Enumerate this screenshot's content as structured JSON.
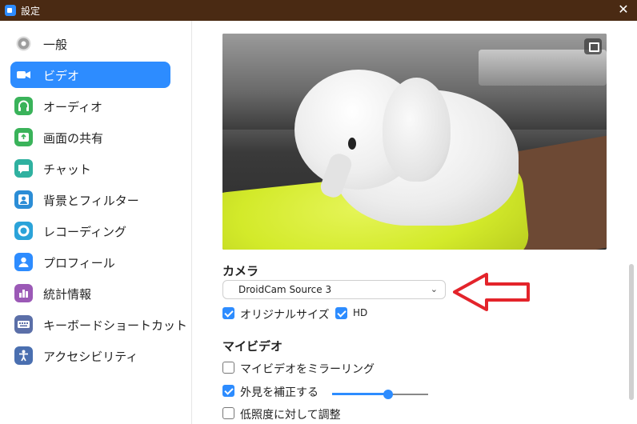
{
  "window": {
    "title": "設定"
  },
  "sidebar": {
    "items": [
      {
        "label": "一般",
        "icon": "gear-icon",
        "color": "#9e9e9e"
      },
      {
        "label": "ビデオ",
        "icon": "camera-icon",
        "color": "#2d8cff",
        "active": true
      },
      {
        "label": "オーディオ",
        "icon": "headphones-icon",
        "color": "#3ab35a"
      },
      {
        "label": "画面の共有",
        "icon": "share-screen-icon",
        "color": "#3ab35a"
      },
      {
        "label": "チャット",
        "icon": "chat-icon",
        "color": "#2fb1a0"
      },
      {
        "label": "背景とフィルター",
        "icon": "background-icon",
        "color": "#2b8dd6"
      },
      {
        "label": "レコーディング",
        "icon": "record-icon",
        "color": "#2ba3d9"
      },
      {
        "label": "プロフィール",
        "icon": "profile-icon",
        "color": "#2d8cff"
      },
      {
        "label": "統計情報",
        "icon": "stats-icon",
        "color": "#9b59b6"
      },
      {
        "label": "キーボードショートカット",
        "icon": "keyboard-icon",
        "color": "#5b6fa8"
      },
      {
        "label": "アクセシビリティ",
        "icon": "accessibility-icon",
        "color": "#4a6fb0"
      }
    ]
  },
  "camera": {
    "title": "カメラ",
    "selected": "DroidCam Source 3",
    "original_size_label": "オリジナルサイズ",
    "original_size_checked": true,
    "hd_label": "HD",
    "hd_checked": true
  },
  "my_video": {
    "title": "マイビデオ",
    "mirror_label": "マイビデオをミラーリング",
    "mirror_checked": false,
    "touch_up_label": "外見を補正する",
    "touch_up_checked": true,
    "touch_up_level": 0.58,
    "low_light_label": "低照度に対して調整",
    "low_light_checked": false
  },
  "colors": {
    "accent": "#2d8cff",
    "titlebar": "#4a2a13",
    "annotation_arrow": "#e3242b"
  }
}
